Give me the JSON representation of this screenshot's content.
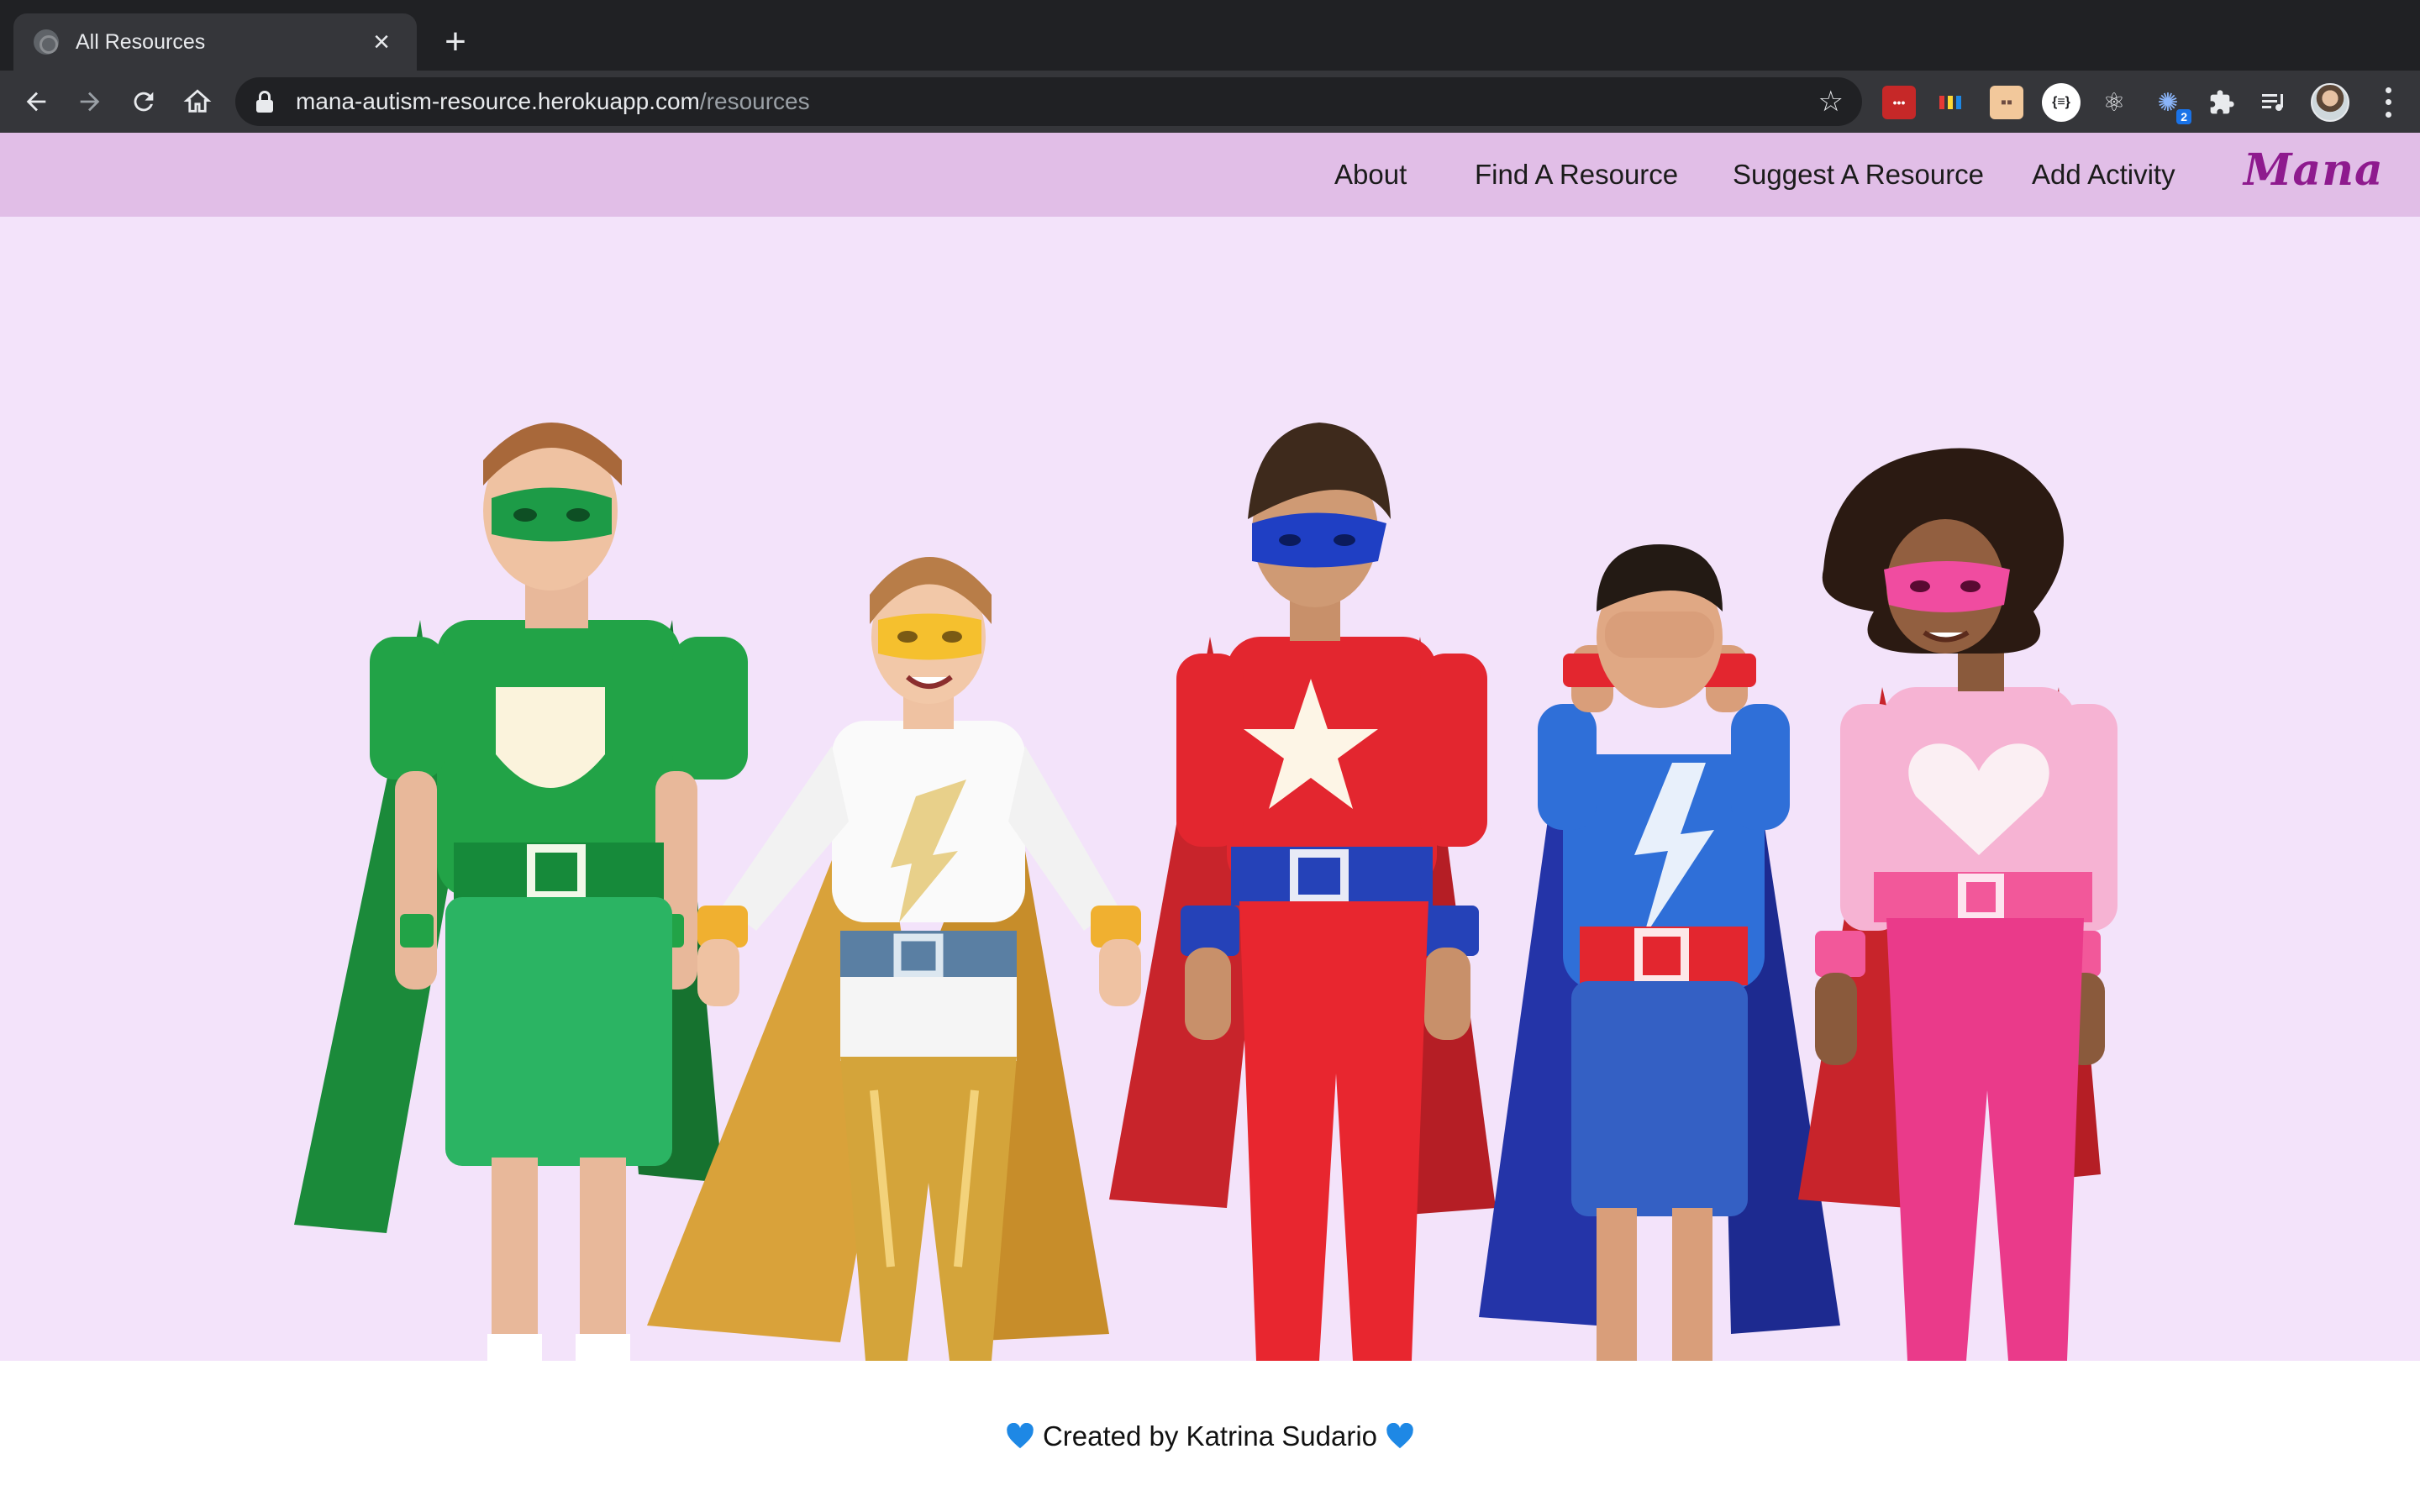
{
  "browser": {
    "tab_title": "All Resources",
    "url_host": "mana-autism-resource.herokuapp.com",
    "url_path": "/resources",
    "extension_badge": "2"
  },
  "nav": {
    "links": [
      "About",
      "Find A Resource",
      "Suggest A Resource",
      "Add Activity"
    ],
    "brand": "Mana"
  },
  "footer": {
    "text": "Created by Katrina Sudario"
  },
  "colors": {
    "nav_bg": "#e1bee7",
    "hero_bg": "#f3e3fa",
    "brand": "#8e1a8e",
    "heart": "#1e88e5"
  }
}
